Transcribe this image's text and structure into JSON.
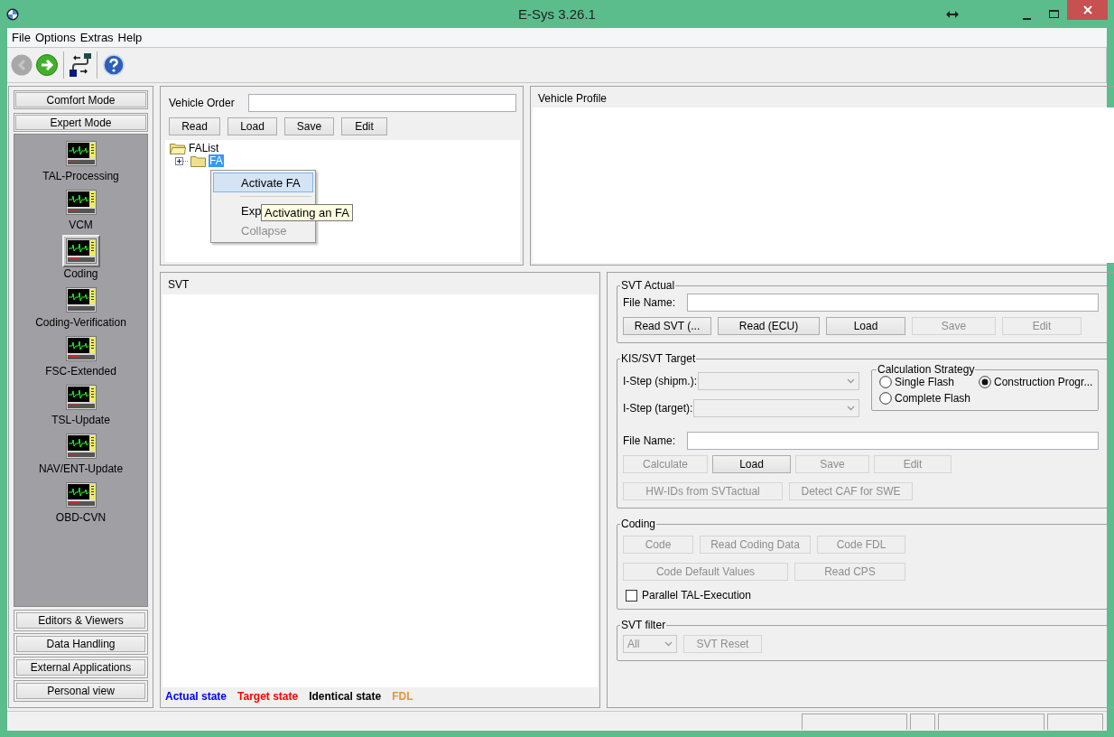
{
  "window": {
    "title": "E-Sys 3.26.1"
  },
  "menu": [
    "File",
    "Options",
    "Extras",
    "Help"
  ],
  "toolbar": [
    {
      "kind": "back",
      "disabled": true
    },
    {
      "kind": "forward",
      "disabled": false
    },
    {
      "kind": "connection"
    },
    {
      "kind": "help"
    }
  ],
  "sidebar": {
    "top_buttons": [
      "Comfort Mode",
      "Expert Mode"
    ],
    "tools": [
      {
        "label": "TAL-Processing",
        "selected": false
      },
      {
        "label": "VCM",
        "selected": false
      },
      {
        "label": "Coding",
        "selected": true
      },
      {
        "label": "Coding-Verification",
        "selected": false
      },
      {
        "label": "FSC-Extended",
        "selected": false
      },
      {
        "label": "TSL-Update",
        "selected": false
      },
      {
        "label": "NAV/ENT-Update",
        "selected": false
      },
      {
        "label": "OBD-CVN",
        "selected": false
      }
    ],
    "bottom_buttons": [
      "Editors & Viewers",
      "Data Handling",
      "External Applications",
      "Personal view"
    ]
  },
  "vehicle_order": {
    "label": "Vehicle Order",
    "buttons": [
      {
        "label": "Read",
        "disabled": false
      },
      {
        "label": "Load",
        "disabled": false
      },
      {
        "label": "Save",
        "disabled": false
      },
      {
        "label": "Edit",
        "disabled": false
      }
    ],
    "tree": [
      {
        "label": "FAList",
        "expanded": true,
        "selected": false,
        "children": [
          {
            "label": "FA",
            "expanded": false,
            "selected": true
          }
        ]
      }
    ],
    "context_menu": [
      {
        "kind": "item",
        "label": "Activate FA",
        "selected": true,
        "disabled": false
      },
      {
        "kind": "separator"
      },
      {
        "kind": "item",
        "label": "Exp",
        "selected": false,
        "disabled": false
      },
      {
        "kind": "item",
        "label": "Collapse",
        "selected": false,
        "disabled": true
      }
    ],
    "tooltip": "Activating an FA"
  },
  "vehicle_profile": {
    "title": "Vehicle Profile"
  },
  "svt": {
    "title": "SVT",
    "legend": [
      {
        "label": "Actual state",
        "color": "#0000ff"
      },
      {
        "label": "Target state",
        "color": "#ff0000"
      },
      {
        "label": "Identical state",
        "color": "#000000"
      },
      {
        "label": "FDL",
        "color": "#e8962e"
      }
    ]
  },
  "svt_actual": {
    "title": "SVT Actual",
    "file_name_label": "File Name:",
    "buttons": [
      {
        "label": "Read SVT (...",
        "disabled": false
      },
      {
        "label": "Read (ECU)",
        "disabled": false
      },
      {
        "label": "Load",
        "disabled": false
      },
      {
        "label": "Save",
        "disabled": true
      },
      {
        "label": "Edit",
        "disabled": true
      }
    ]
  },
  "kis_svt_target": {
    "title": "KIS/SVT Target",
    "i_steps": [
      {
        "label": "I-Step (shipm.):",
        "disabled": true
      },
      {
        "label": "I-Step (target):",
        "disabled": true
      }
    ],
    "calculation_strategy": {
      "title": "Calculation Strategy",
      "options": [
        {
          "label": "Single Flash",
          "selected": false
        },
        {
          "label": "Construction Progr...",
          "selected": true
        },
        {
          "label": "Complete Flash",
          "selected": false
        }
      ]
    },
    "file_name_label": "File Name:",
    "buttons": [
      {
        "label": "Calculate",
        "disabled": true
      },
      {
        "label": "Load",
        "disabled": false
      },
      {
        "label": "Save",
        "disabled": true
      },
      {
        "label": "Edit",
        "disabled": true
      }
    ],
    "buttons_2": [
      {
        "label": "HW-IDs from SVTactual",
        "disabled": true
      },
      {
        "label": "Detect CAF for SWE",
        "disabled": true
      }
    ]
  },
  "coding": {
    "title": "Coding",
    "buttons": [
      {
        "label": "Code",
        "disabled": true
      },
      {
        "label": "Read Coding Data",
        "disabled": true
      },
      {
        "label": "Code FDL",
        "disabled": true
      }
    ],
    "buttons_2": [
      {
        "label": "Code Default Values",
        "disabled": true
      },
      {
        "label": "Read CPS",
        "disabled": true
      }
    ],
    "checkbox": {
      "label": "Parallel TAL-Execution",
      "checked": false
    }
  },
  "svt_filter": {
    "title": "SVT filter",
    "select": {
      "value": "All",
      "disabled": true
    },
    "button": {
      "label": "SVT Reset",
      "disabled": true
    }
  }
}
